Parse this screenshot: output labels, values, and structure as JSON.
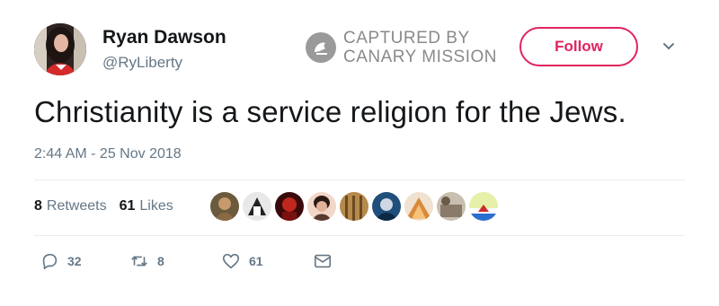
{
  "user": {
    "name": "Ryan Dawson",
    "handle": "@RyLiberty"
  },
  "watermark": {
    "line1": "CAPTURED BY",
    "line2": "CANARY MISSION"
  },
  "follow_label": "Follow",
  "tweet": {
    "text": "Christianity is a service religion for the Jews.",
    "timestamp": "2:44 AM - 25 Nov 2018"
  },
  "stats": {
    "retweets_count": "8",
    "retweets_label": "Retweets",
    "likes_count": "61",
    "likes_label": "Likes"
  },
  "actions": {
    "replies": "32",
    "retweets": "8",
    "likes": "61"
  },
  "colors": {
    "accent": "#e0245e",
    "muted": "#657786",
    "text": "#14171a",
    "watermark": "#8a8a8a"
  },
  "icons": [
    "reply-icon",
    "retweet-icon",
    "heart-icon",
    "message-icon",
    "chevron-down-icon",
    "canary-mission-logo"
  ]
}
